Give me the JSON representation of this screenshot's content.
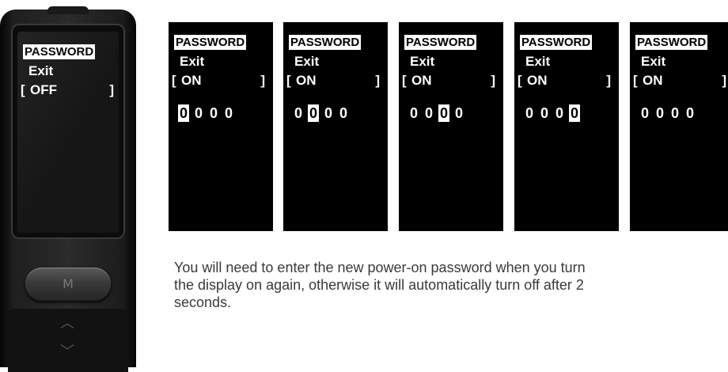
{
  "device": {
    "password_label": "PASSWORD",
    "exit_label": "Exit",
    "status": {
      "open": "[",
      "value": "OFF",
      "close": "]"
    },
    "button_label": "M",
    "up_arrow": "︿",
    "down_arrow": "﹀"
  },
  "panels": [
    {
      "password_label": "PASSWORD",
      "exit_label": "Exit",
      "open": "[",
      "value": "ON",
      "close": "]",
      "digits": [
        "0",
        "0",
        "0",
        "0"
      ],
      "selected_digit": 1
    },
    {
      "password_label": "PASSWORD",
      "exit_label": "Exit",
      "open": "[",
      "value": "ON",
      "close": "]",
      "digits": [
        "0",
        "0",
        "0",
        "0"
      ],
      "selected_digit": 2
    },
    {
      "password_label": "PASSWORD",
      "exit_label": "Exit",
      "open": "[",
      "value": "ON",
      "close": "]",
      "digits": [
        "0",
        "0",
        "0",
        "0"
      ],
      "selected_digit": 3
    },
    {
      "password_label": "PASSWORD",
      "exit_label": "Exit",
      "open": "[",
      "value": "ON",
      "close": "]",
      "digits": [
        "0",
        "0",
        "0",
        "0"
      ],
      "selected_digit": 4
    },
    {
      "password_label": "PASSWORD",
      "exit_label": "Exit",
      "open": "[",
      "value": "ON",
      "close": "]",
      "digits": [
        "0",
        "0",
        "0",
        "0"
      ],
      "selected_digit": 0
    }
  ],
  "caption": "You will need to enter the new power-on password when you turn\nthe display on again, otherwise it will automatically turn off after 2\nseconds.",
  "colors": {
    "lcd_bg": "#000000",
    "lcd_text": "#ffffff",
    "caption_text": "#3a3a3a"
  }
}
